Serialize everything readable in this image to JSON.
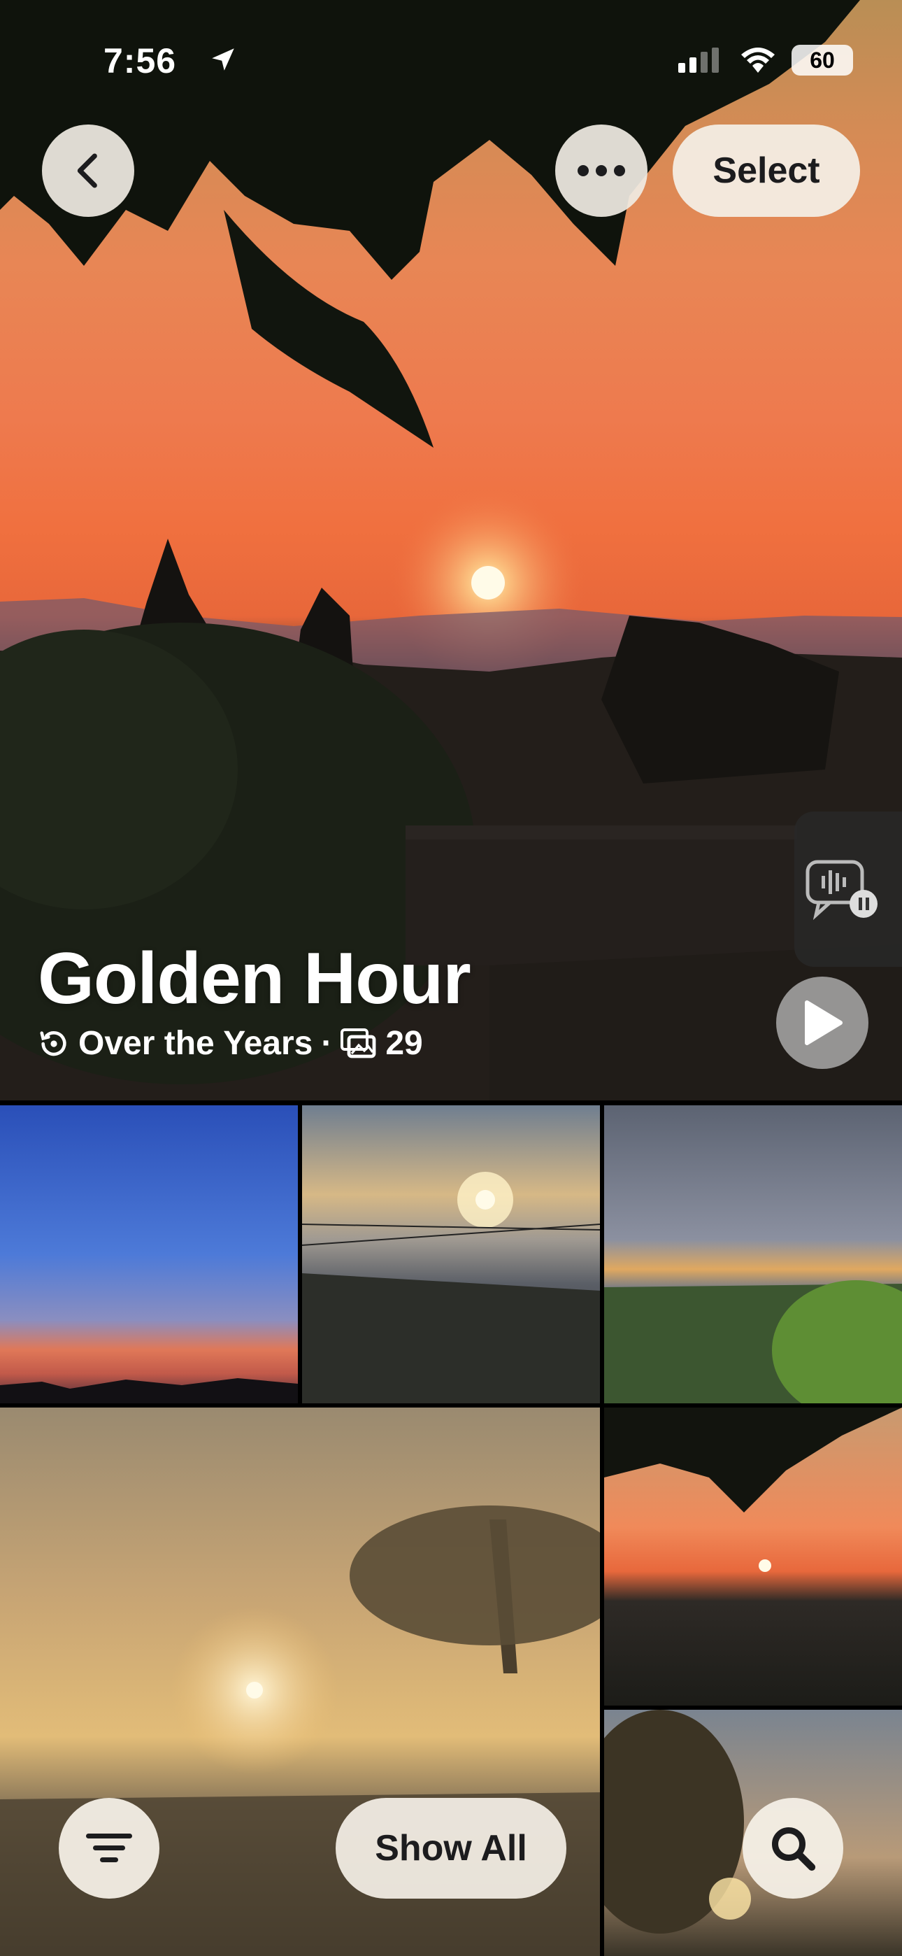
{
  "status_bar": {
    "time": "7:56",
    "battery": "60",
    "icons": [
      "location-arrow-icon",
      "cellular-signal-icon",
      "wifi-icon",
      "battery-icon"
    ]
  },
  "top_bar": {
    "back_icon": "chevron-left-icon",
    "more_icon": "ellipsis-icon",
    "select_label": "Select"
  },
  "memory": {
    "title": "Golden Hour",
    "collection_label": "Over the Years",
    "separator": "·",
    "item_count": "29",
    "icons": [
      "history-icon",
      "photos-stack-icon"
    ]
  },
  "controls": {
    "side_tab_icon": "narration-pause-icon",
    "play_icon": "play-icon"
  },
  "grid": {
    "photos": [
      {
        "label": "blue-sky-sunset"
      },
      {
        "label": "cloudy-sun-wires"
      },
      {
        "label": "overcast-trees"
      },
      {
        "label": "ocean-palm-sunset"
      },
      {
        "label": "branch-sunset"
      },
      {
        "label": "tree-sunburst"
      }
    ]
  },
  "bottom_bar": {
    "filter_icon": "filter-lines-icon",
    "show_all_label": "Show All",
    "search_icon": "search-icon"
  }
}
